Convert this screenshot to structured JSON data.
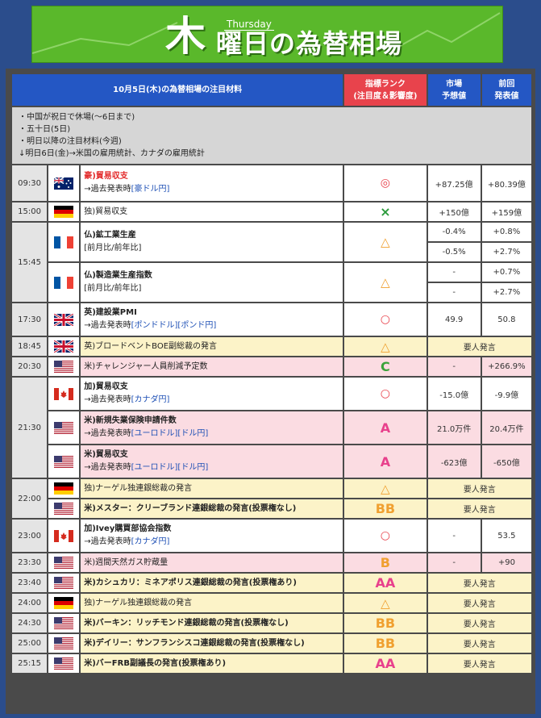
{
  "banner": {
    "big": "木",
    "rest": "曜日の為替相場",
    "day": "Thursday"
  },
  "header": {
    "title": "10月5日(木)の為替相場の注目材料",
    "rank1": "指標ランク",
    "rank2": "(注目度＆影響度)",
    "fc1": "市場",
    "fc2": "予想値",
    "pv1": "前回",
    "pv2": "発表値"
  },
  "notes": [
    "・中国が祝日で休場(〜6日まで)",
    "・五十日(5日)",
    "・明日以降の注目材料(今週)",
    "↓明日6日(金)→米国の雇用統計、カナダの雇用統計"
  ],
  "common": {
    "prev_pub": "→過去発表時",
    "sub_mom_yoy": "[前月比/前年比]",
    "speech": "要人発言"
  },
  "rows": {
    "r1": {
      "time": "09:30",
      "event": "豪)貿易収支",
      "links": "[豪ドル円]",
      "rank": "◎",
      "fc": "+87.25億",
      "pv": "+80.39億"
    },
    "r2": {
      "time": "15:00",
      "event": "独)貿易収支",
      "rank": "×",
      "fc": "+150億",
      "pv": "+159億"
    },
    "r3": {
      "time": "15:45",
      "event": "仏)鉱工業生産",
      "rank": "△",
      "fc_a": "-0.4%",
      "pv_a": "+0.8%",
      "fc_b": "-0.5%",
      "pv_b": "+2.7%"
    },
    "r4": {
      "event": "仏)製造業生産指数",
      "rank": "△",
      "fc_a": "-",
      "pv_a": "+0.7%",
      "fc_b": "-",
      "pv_b": "+2.7%"
    },
    "r5": {
      "time": "17:30",
      "event": "英)建設業PMI",
      "links": "[ポンドドル][ポンド円]",
      "rank": "○",
      "fc": "49.9",
      "pv": "50.8"
    },
    "r6": {
      "time": "18:45",
      "event": "英)ブロードベントBOE副総裁の発言",
      "rank": "△"
    },
    "r7": {
      "time": "20:30",
      "event": "米)チャレンジャー人員削減予定数",
      "rank": "C",
      "fc": "-",
      "pv": "+266.9%"
    },
    "r8": {
      "time": "21:30",
      "event": "加)貿易収支",
      "links": "[カナダ円]",
      "rank": "○",
      "fc": "-15.0億",
      "pv": "-9.9億"
    },
    "r9": {
      "event": "米)新規失業保険申請件数",
      "links": "[ユーロドル][ドル円]",
      "rank": "A",
      "fc": "21.0万件",
      "pv": "20.4万件"
    },
    "r10": {
      "event": "米)貿易収支",
      "links": "[ユーロドル][ドル円]",
      "rank": "A",
      "fc": "-623億",
      "pv": "-650億"
    },
    "r11": {
      "time": "22:00",
      "event": "独)ナーゲル独連銀総裁の発言",
      "rank": "△"
    },
    "r12": {
      "event": "米)メスター：クリーブランド連銀総裁の発言(投票権なし)",
      "rank": "BB"
    },
    "r13": {
      "time": "23:00",
      "event": "加)Ivey購買部協会指数",
      "links": "[カナダ円]",
      "rank": "○",
      "fc": "-",
      "pv": "53.5"
    },
    "r14": {
      "time": "23:30",
      "event": "米)週間天然ガス貯蔵量",
      "rank": "B",
      "fc": "-",
      "pv": "+90"
    },
    "r15": {
      "time": "23:40",
      "event": "米)カシュカリ：ミネアポリス連銀総裁の発言(投票権あり)",
      "rank": "AA"
    },
    "r16": {
      "time": "24:00",
      "event": "独)ナーゲル独連銀総裁の発言",
      "rank": "△"
    },
    "r17": {
      "time": "24:30",
      "event": "米)バーキン：リッチモンド連銀総裁の発言(投票権なし)",
      "rank": "BB"
    },
    "r18": {
      "time": "25:00",
      "event": "米)デイリー：サンフランシスコ連銀総裁の発言(投票権なし)",
      "rank": "BB"
    },
    "r19": {
      "time": "25:15",
      "event": "米)バーFRB副議長の発言(投票権あり)",
      "rank": "AA"
    },
    "t2130": "21:30"
  },
  "colors": {
    "banner": "#5ab82b",
    "header": "#2457c4",
    "rank_header": "#e8434c",
    "background": "#2b4d8c"
  }
}
